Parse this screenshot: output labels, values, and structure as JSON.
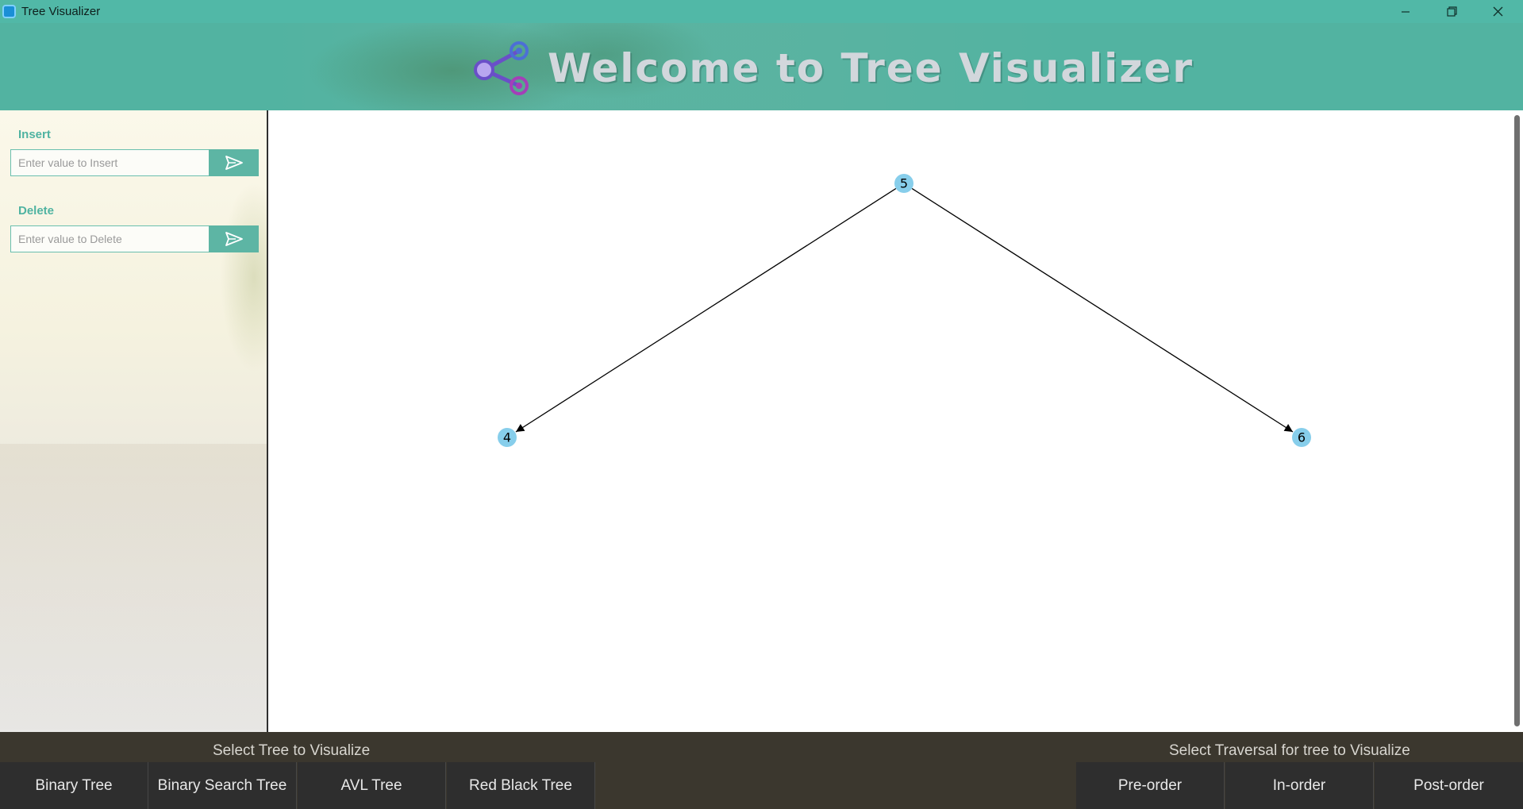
{
  "window": {
    "title": "Tree Visualizer",
    "controls": [
      "minimize-icon",
      "restore-icon",
      "close-icon"
    ]
  },
  "header": {
    "headline": "Welcome to Tree Visualizer",
    "logo_icon": "share-nodes-icon"
  },
  "sidebar": {
    "insert": {
      "label": "Insert",
      "placeholder": "Enter value to Insert",
      "value": "",
      "button_icon": "send-icon"
    },
    "delete": {
      "label": "Delete",
      "placeholder": "Enter value to Delete",
      "value": "",
      "button_icon": "send-icon"
    }
  },
  "tree": {
    "nodes": [
      {
        "id": "n5",
        "value": "5"
      },
      {
        "id": "n4",
        "value": "4"
      },
      {
        "id": "n6",
        "value": "6"
      }
    ],
    "edges": [
      {
        "from": "n5",
        "to": "n4"
      },
      {
        "from": "n5",
        "to": "n6"
      }
    ],
    "node_color": "#87ceeb"
  },
  "bottom": {
    "tree_caption": "Select Tree to Visualize",
    "traversal_caption": "Select Traversal for tree to Visualize",
    "tree_types": [
      "Binary Tree",
      "Binary Search Tree",
      "AVL Tree",
      "Red Black Tree"
    ],
    "traversals": [
      "Pre-order",
      "In-order",
      "Post-order"
    ]
  },
  "colors": {
    "accent": "#51b8a7",
    "bottom_bar": "#3b372e",
    "button_dark": "#2e2e2e"
  }
}
